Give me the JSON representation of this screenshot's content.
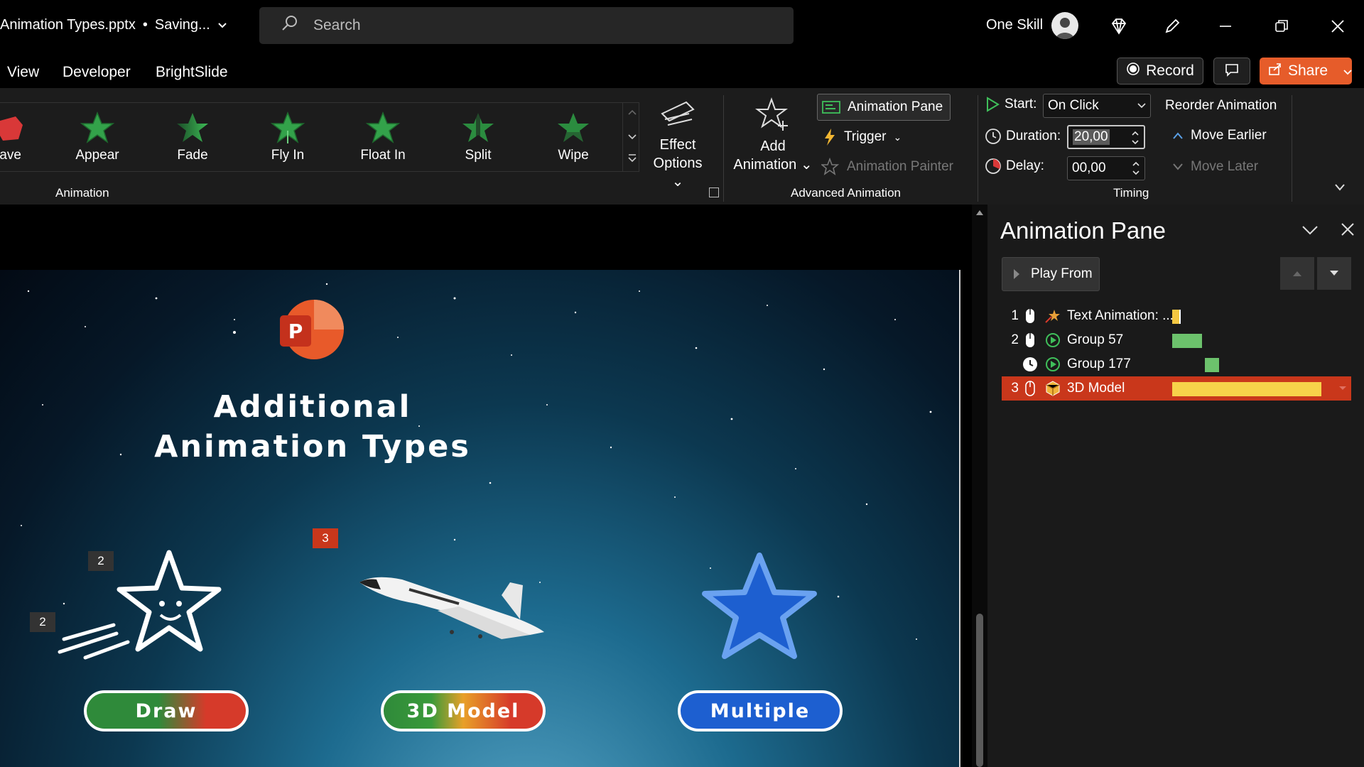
{
  "titlebar": {
    "doc_name": "Animation Types.pptx",
    "status": "Saving...",
    "search_placeholder": "Search",
    "user_name": "One Skill"
  },
  "menu": {
    "items": [
      "View",
      "Developer",
      "BrightSlide"
    ],
    "record_label": "Record",
    "share_label": "Share"
  },
  "ribbon": {
    "animations": [
      {
        "label": "ave"
      },
      {
        "label": "Appear"
      },
      {
        "label": "Fade"
      },
      {
        "label": "Fly In"
      },
      {
        "label": "Float In"
      },
      {
        "label": "Split"
      },
      {
        "label": "Wipe"
      }
    ],
    "effect_options_label_1": "Effect",
    "effect_options_label_2": "Options",
    "animation_group_label": "Animation",
    "add_animation_label_1": "Add",
    "add_animation_label_2": "Animation",
    "animation_pane_label": "Animation Pane",
    "trigger_label": "Trigger",
    "animation_painter_label": "Animation Painter",
    "advanced_group_label": "Advanced Animation",
    "start_label": "Start:",
    "start_value": "On Click",
    "duration_label": "Duration:",
    "duration_value": "20,00",
    "delay_label": "Delay:",
    "delay_value": "00,00",
    "timing_group_label": "Timing",
    "reorder_label": "Reorder Animation",
    "move_earlier_label": "Move Earlier",
    "move_later_label": "Move Later"
  },
  "slide": {
    "title_line1": "Additional",
    "title_line2": "Animation Types",
    "tags": [
      "2",
      "2",
      "3"
    ],
    "buttons": [
      "Draw",
      "3D Model",
      "Multiple"
    ]
  },
  "pane": {
    "title": "Animation Pane",
    "play_from_label": "Play From",
    "rows": [
      {
        "num": "1",
        "name": "Text Animation: ...",
        "bar_color": "#f5c842"
      },
      {
        "num": "2",
        "name": "Group 57",
        "bar_color": "#6cc26c"
      },
      {
        "num": "",
        "name": "Group 177",
        "bar_color": "#6cc26c"
      },
      {
        "num": "3",
        "name": "3D Model",
        "bar_color": "#f7d24a"
      }
    ]
  },
  "colors": {
    "accent": "#e65c2a",
    "selected_row": "#c9371b",
    "ribbon_bg": "#1c1c1c"
  }
}
